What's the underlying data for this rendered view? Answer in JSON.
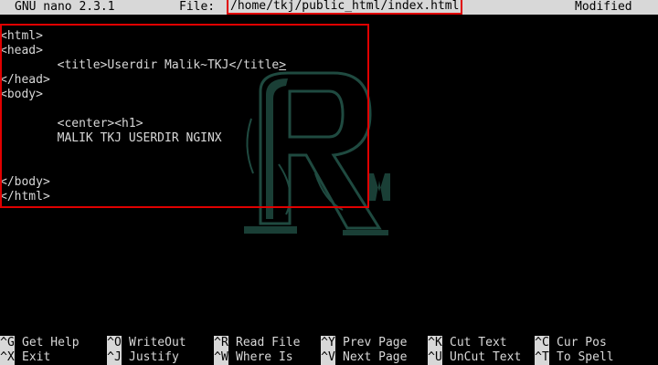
{
  "titlebar": {
    "app": "GNU nano 2.3.1",
    "file_label": "File:",
    "file_path": "/home/tkj/public_html/index.html",
    "status": "Modified"
  },
  "editor": {
    "lines": [
      "<html>",
      "<head>",
      "        <title>Userdir Malik~TKJ</title",
      "</head>",
      "<body>",
      "",
      "        <center><h1>",
      "        MALIK TKJ USERDIR NGINX",
      "",
      "",
      "</body>",
      "</html>"
    ],
    "cursor_after": ">"
  },
  "shortcuts": [
    {
      "key": "^G",
      "label": "Get Help"
    },
    {
      "key": "^O",
      "label": "WriteOut"
    },
    {
      "key": "^R",
      "label": "Read File"
    },
    {
      "key": "^Y",
      "label": "Prev Page"
    },
    {
      "key": "^K",
      "label": "Cut Text"
    },
    {
      "key": "^C",
      "label": "Cur Pos"
    },
    {
      "key": "^X",
      "label": "Exit"
    },
    {
      "key": "^J",
      "label": "Justify"
    },
    {
      "key": "^W",
      "label": "Where Is"
    },
    {
      "key": "^V",
      "label": "Next Page"
    },
    {
      "key": "^U",
      "label": "UnCut Text"
    },
    {
      "key": "^T",
      "label": "To Spell"
    }
  ],
  "colors": {
    "background": "#000000",
    "foreground": "#d8d8d8",
    "highlight": "#e00000",
    "watermark": "#1f4a40"
  },
  "watermark": {
    "letters": "RM",
    "icon": "rm-logo-watermark"
  }
}
